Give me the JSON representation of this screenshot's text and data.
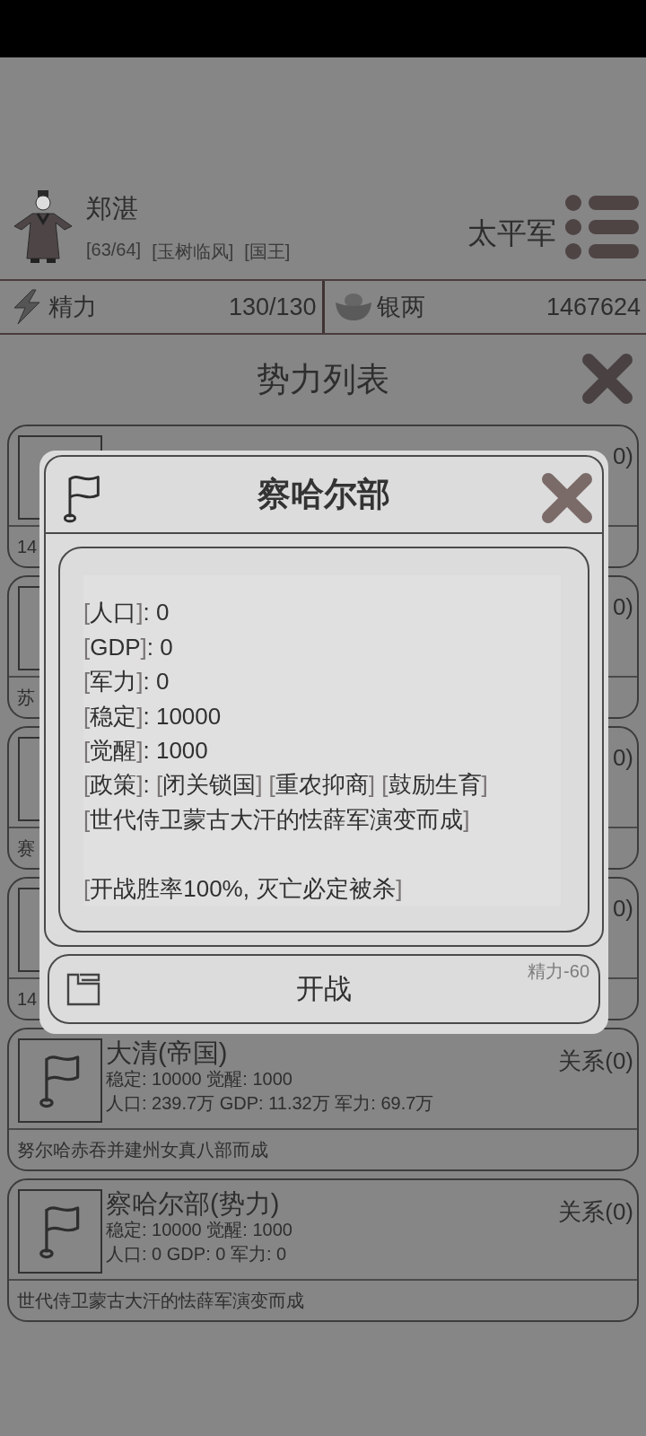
{
  "player": {
    "name": "郑湛",
    "tags": [
      "[63/64]",
      "[玉树临风]",
      "[国王]"
    ],
    "faction": "太平军"
  },
  "resources": [
    {
      "kind": "energy",
      "label": "精力",
      "value": "130/130"
    },
    {
      "kind": "silver",
      "label": "银两",
      "value": "1467624"
    }
  ],
  "page_title": "势力列表",
  "factions": [
    {
      "relation": "0)",
      "description": "14"
    },
    {
      "relation": "0)",
      "description": "苏"
    },
    {
      "relation": "0)",
      "description": "赛"
    },
    {
      "relation": "0)",
      "description": "14"
    },
    {
      "title": "大清(帝国)",
      "relation": "关系(0)",
      "stats_1": "稳定: 10000 觉醒: 1000",
      "stats_2": "人口: 239.7万 GDP: 11.32万 军力: 69.7万",
      "description": "努尔哈赤吞并建州女真八部而成"
    },
    {
      "title": "察哈尔部(势力)",
      "relation": "关系(0)",
      "stats_1": "稳定: 10000 觉醒: 1000",
      "stats_2": "人口: 0 GDP: 0 军力: 0",
      "description": "世代侍卫蒙古大汗的怯薛军演变而成"
    }
  ],
  "dialog": {
    "title": "察哈尔部",
    "lines": [
      {
        "spaced": false,
        "segments": [
          {
            "text": "[",
            "dim": true
          },
          {
            "text": "人口",
            "dim": false
          },
          {
            "text": "]",
            "dim": true
          },
          {
            "text": ": 0",
            "dim": false
          }
        ]
      },
      {
        "spaced": false,
        "segments": [
          {
            "text": "[",
            "dim": true
          },
          {
            "text": "GDP",
            "dim": false
          },
          {
            "text": "]",
            "dim": true
          },
          {
            "text": ": 0",
            "dim": false
          }
        ]
      },
      {
        "spaced": false,
        "segments": [
          {
            "text": "[",
            "dim": true
          },
          {
            "text": "军力",
            "dim": false
          },
          {
            "text": "]",
            "dim": true
          },
          {
            "text": ": 0",
            "dim": false
          }
        ]
      },
      {
        "spaced": false,
        "segments": [
          {
            "text": "[",
            "dim": true
          },
          {
            "text": "稳定",
            "dim": false
          },
          {
            "text": "]",
            "dim": true
          },
          {
            "text": ": 10000",
            "dim": false
          }
        ]
      },
      {
        "spaced": false,
        "segments": [
          {
            "text": "[",
            "dim": true
          },
          {
            "text": "觉醒",
            "dim": false
          },
          {
            "text": "]",
            "dim": true
          },
          {
            "text": ": 1000",
            "dim": false
          }
        ]
      },
      {
        "spaced": false,
        "segments": [
          {
            "text": "[",
            "dim": true
          },
          {
            "text": "政策",
            "dim": false
          },
          {
            "text": "]",
            "dim": true
          },
          {
            "text": ": ",
            "dim": false
          },
          {
            "text": "[",
            "dim": true
          },
          {
            "text": "闭关锁国",
            "dim": false
          },
          {
            "text": "]  [",
            "dim": true
          },
          {
            "text": "重农抑商",
            "dim": false
          },
          {
            "text": "]  [",
            "dim": true
          },
          {
            "text": "鼓励生育",
            "dim": false
          },
          {
            "text": "]",
            "dim": true
          }
        ]
      },
      {
        "spaced": false,
        "segments": [
          {
            "text": "[",
            "dim": true
          },
          {
            "text": "世代侍卫蒙古大汗的怯薛军演变而成",
            "dim": false
          },
          {
            "text": "]",
            "dim": true
          }
        ]
      },
      {
        "spaced": true,
        "segments": [
          {
            "text": "[",
            "dim": true
          },
          {
            "text": "开战胜率100%, 灭亡必定被杀",
            "dim": false
          },
          {
            "text": "]",
            "dim": true
          }
        ]
      }
    ],
    "action": {
      "label": "开战",
      "cost": "精力-60"
    }
  }
}
